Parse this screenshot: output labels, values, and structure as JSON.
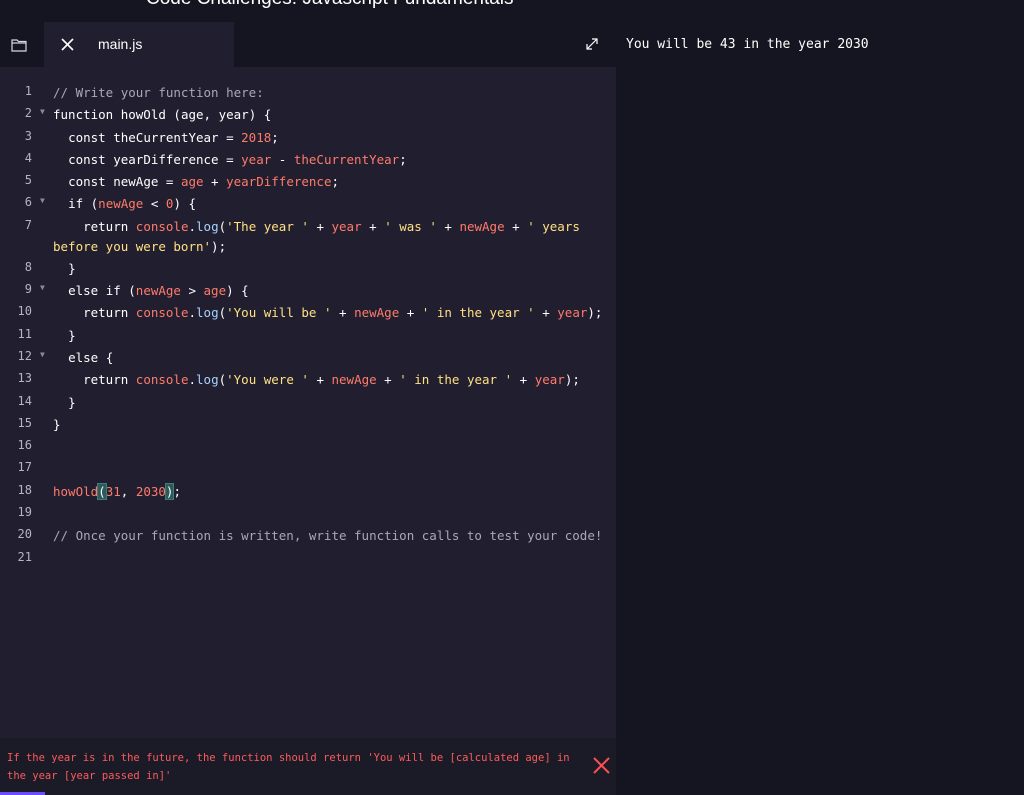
{
  "header": {
    "title": "Code Challenges: Javascript Fundamentals"
  },
  "editor": {
    "active_tab": "main.js",
    "lines": [
      {
        "n": "1",
        "fold": false,
        "tokens": [
          {
            "t": "// Write your function here:",
            "c": "cm"
          }
        ]
      },
      {
        "n": "2",
        "fold": true,
        "tokens": [
          {
            "t": "function ",
            "c": "kw"
          },
          {
            "t": "howOld",
            "c": "def"
          },
          {
            "t": " (",
            "c": "def"
          },
          {
            "t": "age",
            "c": "def"
          },
          {
            "t": ", ",
            "c": "def"
          },
          {
            "t": "year",
            "c": "def"
          },
          {
            "t": ") {",
            "c": "def"
          }
        ]
      },
      {
        "n": "3",
        "fold": false,
        "tokens": [
          {
            "t": "  const ",
            "c": "kw"
          },
          {
            "t": "theCurrentYear",
            "c": "def"
          },
          {
            "t": " = ",
            "c": "def"
          },
          {
            "t": "2018",
            "c": "num"
          },
          {
            "t": ";",
            "c": "def"
          }
        ]
      },
      {
        "n": "4",
        "fold": false,
        "tokens": [
          {
            "t": "  const ",
            "c": "kw"
          },
          {
            "t": "yearDifference",
            "c": "def"
          },
          {
            "t": " = ",
            "c": "def"
          },
          {
            "t": "year",
            "c": "var"
          },
          {
            "t": " - ",
            "c": "def"
          },
          {
            "t": "theCurrentYear",
            "c": "var"
          },
          {
            "t": ";",
            "c": "def"
          }
        ]
      },
      {
        "n": "5",
        "fold": false,
        "tokens": [
          {
            "t": "  const ",
            "c": "kw"
          },
          {
            "t": "newAge",
            "c": "def"
          },
          {
            "t": " = ",
            "c": "def"
          },
          {
            "t": "age",
            "c": "var"
          },
          {
            "t": " + ",
            "c": "def"
          },
          {
            "t": "yearDifference",
            "c": "var"
          },
          {
            "t": ";",
            "c": "def"
          }
        ]
      },
      {
        "n": "6",
        "fold": true,
        "tokens": [
          {
            "t": "  if (",
            "c": "kw"
          },
          {
            "t": "newAge",
            "c": "var"
          },
          {
            "t": " < ",
            "c": "def"
          },
          {
            "t": "0",
            "c": "num"
          },
          {
            "t": ") {",
            "c": "def"
          }
        ]
      },
      {
        "n": "7",
        "fold": false,
        "tall": true,
        "tokens": [
          {
            "t": "    return ",
            "c": "kw"
          },
          {
            "t": "console",
            "c": "var"
          },
          {
            "t": ".",
            "c": "def"
          },
          {
            "t": "log",
            "c": "prop"
          },
          {
            "t": "(",
            "c": "def"
          },
          {
            "t": "'The year '",
            "c": "str"
          },
          {
            "t": " + ",
            "c": "def"
          },
          {
            "t": "year",
            "c": "var"
          },
          {
            "t": " + ",
            "c": "def"
          },
          {
            "t": "' was '",
            "c": "str"
          },
          {
            "t": " + ",
            "c": "def"
          },
          {
            "t": "newAge",
            "c": "var"
          },
          {
            "t": " + ",
            "c": "def"
          },
          {
            "t": "' years before you were born'",
            "c": "str"
          },
          {
            "t": ");",
            "c": "def"
          }
        ]
      },
      {
        "n": "8",
        "fold": false,
        "tokens": [
          {
            "t": "  }",
            "c": "def"
          }
        ]
      },
      {
        "n": "9",
        "fold": true,
        "tokens": [
          {
            "t": "  else if (",
            "c": "kw"
          },
          {
            "t": "newAge",
            "c": "var"
          },
          {
            "t": " > ",
            "c": "def"
          },
          {
            "t": "age",
            "c": "var"
          },
          {
            "t": ") {",
            "c": "def"
          }
        ]
      },
      {
        "n": "10",
        "fold": false,
        "tokens": [
          {
            "t": "    return ",
            "c": "kw"
          },
          {
            "t": "console",
            "c": "var"
          },
          {
            "t": ".",
            "c": "def"
          },
          {
            "t": "log",
            "c": "prop"
          },
          {
            "t": "(",
            "c": "def"
          },
          {
            "t": "'You will be '",
            "c": "str"
          },
          {
            "t": " + ",
            "c": "def"
          },
          {
            "t": "newAge",
            "c": "var"
          },
          {
            "t": " + ",
            "c": "def"
          },
          {
            "t": "' in the year '",
            "c": "str"
          },
          {
            "t": " + ",
            "c": "def"
          },
          {
            "t": "year",
            "c": "var"
          },
          {
            "t": ");",
            "c": "def"
          }
        ]
      },
      {
        "n": "11",
        "fold": false,
        "tokens": [
          {
            "t": "  }",
            "c": "def"
          }
        ]
      },
      {
        "n": "12",
        "fold": true,
        "tokens": [
          {
            "t": "  else {",
            "c": "kw"
          }
        ]
      },
      {
        "n": "13",
        "fold": false,
        "tokens": [
          {
            "t": "    return ",
            "c": "kw"
          },
          {
            "t": "console",
            "c": "var"
          },
          {
            "t": ".",
            "c": "def"
          },
          {
            "t": "log",
            "c": "prop"
          },
          {
            "t": "(",
            "c": "def"
          },
          {
            "t": "'You were '",
            "c": "str"
          },
          {
            "t": " + ",
            "c": "def"
          },
          {
            "t": "newAge",
            "c": "var"
          },
          {
            "t": " + ",
            "c": "def"
          },
          {
            "t": "' in the year '",
            "c": "str"
          },
          {
            "t": " + ",
            "c": "def"
          },
          {
            "t": "year",
            "c": "var"
          },
          {
            "t": ");",
            "c": "def"
          }
        ]
      },
      {
        "n": "14",
        "fold": false,
        "tokens": [
          {
            "t": "  }",
            "c": "def"
          }
        ]
      },
      {
        "n": "15",
        "fold": false,
        "tokens": [
          {
            "t": "}",
            "c": "def"
          }
        ]
      },
      {
        "n": "16",
        "fold": false,
        "tokens": []
      },
      {
        "n": "17",
        "fold": false,
        "tokens": []
      },
      {
        "n": "18",
        "fold": false,
        "tokens": [
          {
            "t": "howOld",
            "c": "var"
          },
          {
            "t": "(",
            "c": "def",
            "hl": true
          },
          {
            "t": "31",
            "c": "num"
          },
          {
            "t": ", ",
            "c": "def"
          },
          {
            "t": "2030",
            "c": "num"
          },
          {
            "t": ")",
            "c": "def",
            "hl": true
          },
          {
            "t": ";",
            "c": "def"
          }
        ]
      },
      {
        "n": "19",
        "fold": false,
        "tokens": []
      },
      {
        "n": "20",
        "fold": false,
        "tokens": [
          {
            "t": "// Once your function is written, write function calls to test your code!",
            "c": "cm"
          }
        ]
      },
      {
        "n": "21",
        "fold": false,
        "tokens": []
      }
    ]
  },
  "output": {
    "text": "You will be 43 in the year 2030"
  },
  "feedback": {
    "message": "If the year is in the future, the function should return 'You will be [calculated age] in the year [year passed in]'",
    "status": "fail",
    "progress_percent": 7.3
  },
  "colors": {
    "error": "#ff5a5a",
    "accent": "#6d4cff",
    "editor_bg": "#211e2f"
  },
  "icons": {
    "folder": "folder-icon",
    "close": "close-icon",
    "expand": "expand-icon",
    "fail": "x-icon"
  }
}
